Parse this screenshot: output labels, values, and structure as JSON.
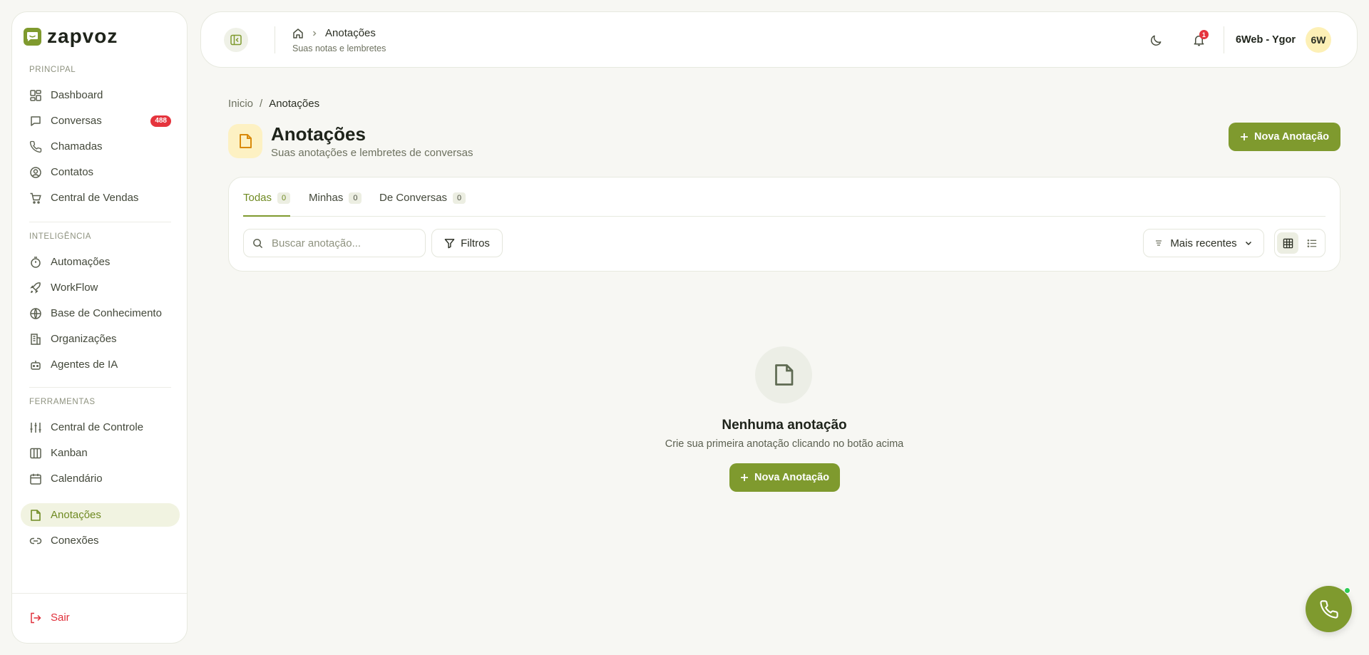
{
  "brand": {
    "name": "zapvoz",
    "accent": "#7f9a2e"
  },
  "sidebar": {
    "sections": [
      {
        "label": "PRINCIPAL"
      },
      {
        "label": "INTELIGÊNCIA"
      },
      {
        "label": "FERRAMENTAS"
      }
    ],
    "items": [
      {
        "label": "Dashboard",
        "icon": "dashboard-icon"
      },
      {
        "label": "Conversas",
        "icon": "chat-icon",
        "badge": "488"
      },
      {
        "label": "Chamadas",
        "icon": "phone-icon"
      },
      {
        "label": "Contatos",
        "icon": "user-circle-icon"
      },
      {
        "label": "Central de Vendas",
        "icon": "cart-icon"
      },
      {
        "label": "Automações",
        "icon": "timer-icon"
      },
      {
        "label": "WorkFlow",
        "icon": "rocket-icon"
      },
      {
        "label": "Base de Conhecimento",
        "icon": "globe-icon"
      },
      {
        "label": "Organizações",
        "icon": "building-icon"
      },
      {
        "label": "Agentes de IA",
        "icon": "bot-icon"
      },
      {
        "label": "Central de Controle",
        "icon": "sliders-icon"
      },
      {
        "label": "Kanban",
        "icon": "columns-icon"
      },
      {
        "label": "Calendário",
        "icon": "calendar-icon"
      },
      {
        "label": "Anotações",
        "icon": "note-icon",
        "active": true
      },
      {
        "label": "Conexões",
        "icon": "link-icon"
      }
    ],
    "logout_label": "Sair"
  },
  "topbar": {
    "crumb": "Anotações",
    "subtitle": "Suas notas e lembretes",
    "notifications": "1",
    "user_name": "6Web - Ygor",
    "avatar_initials": "6W"
  },
  "main": {
    "breadcrumb": {
      "home": "Inicio",
      "separator": "/",
      "current": "Anotações"
    },
    "title": "Anotações",
    "subtitle": "Suas anotações e lembretes de conversas",
    "new_button": "Nova Anotação",
    "tabs": [
      {
        "label": "Todas",
        "count": "0",
        "active": true
      },
      {
        "label": "Minhas",
        "count": "0"
      },
      {
        "label": "De Conversas",
        "count": "0"
      }
    ],
    "search": {
      "placeholder": "Buscar anotação...",
      "value": ""
    },
    "filters_label": "Filtros",
    "sort_label": "Mais recentes",
    "empty": {
      "title": "Nenhuma anotação",
      "subtitle": "Crie sua primeira anotação clicando no botão acima",
      "button": "Nova Anotação"
    }
  }
}
